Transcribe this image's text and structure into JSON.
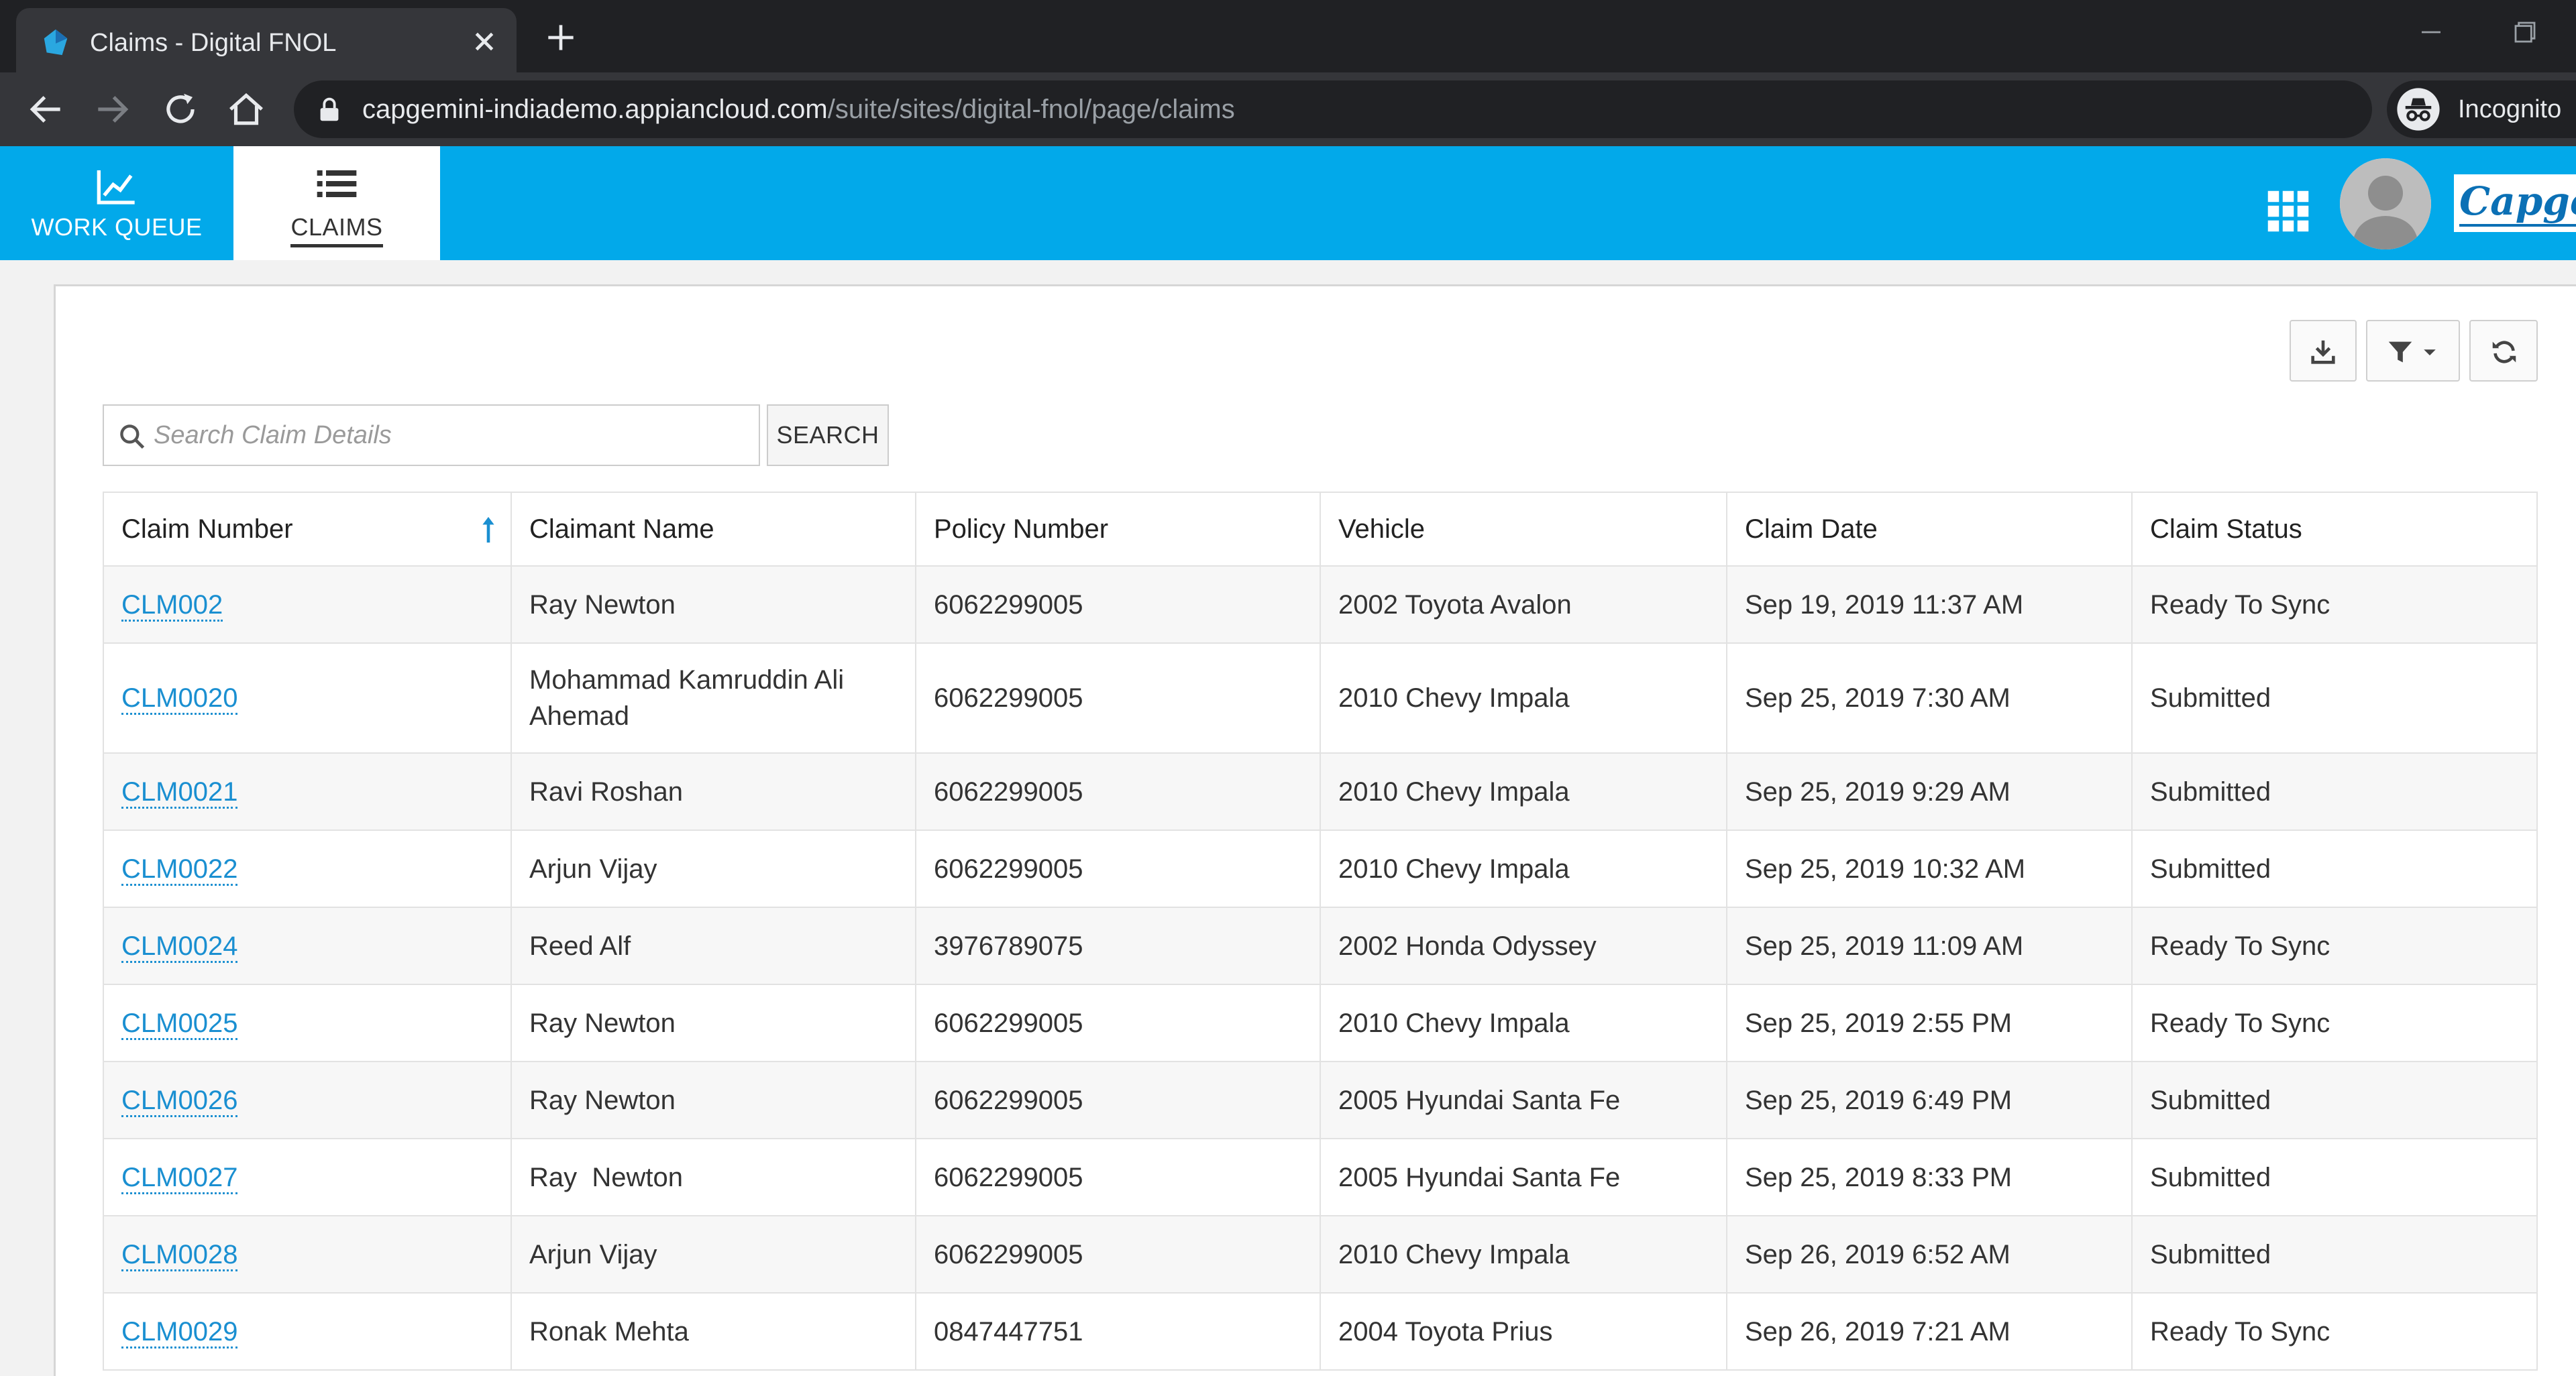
{
  "browser": {
    "tab_title": "Claims - Digital FNOL",
    "url_host": "capgemini-indiademo.appiancloud.com",
    "url_path": "/suite/sites/digital-fnol/page/claims",
    "profile_label": "Incognito"
  },
  "app": {
    "nav": {
      "work_queue": "WORK QUEUE",
      "claims": "CLAIMS"
    },
    "logo_text": "Capgemini",
    "colors": {
      "header": "#02a9ea",
      "link": "#1a8fd1"
    }
  },
  "search": {
    "placeholder": "Search Claim Details",
    "value": "",
    "button_label": "SEARCH"
  },
  "table": {
    "columns": [
      "Claim Number",
      "Claimant Name",
      "Policy Number",
      "Vehicle",
      "Claim Date",
      "Claim Status"
    ],
    "sorted_column": "Claim Number",
    "sort_direction": "ascending",
    "rows": [
      {
        "claim_number": "CLM002",
        "claimant": "Ray Newton",
        "policy": "6062299005",
        "vehicle": "2002 Toyota Avalon",
        "date": "Sep 19, 2019 11:37 AM",
        "status": "Ready To Sync"
      },
      {
        "claim_number": "CLM0020",
        "claimant": "Mohammad Kamruddin Ali Ahemad",
        "policy": "6062299005",
        "vehicle": "2010 Chevy Impala",
        "date": "Sep 25, 2019 7:30 AM",
        "status": "Submitted"
      },
      {
        "claim_number": "CLM0021",
        "claimant": "Ravi Roshan",
        "policy": "6062299005",
        "vehicle": "2010 Chevy Impala",
        "date": "Sep 25, 2019 9:29 AM",
        "status": "Submitted"
      },
      {
        "claim_number": "CLM0022",
        "claimant": "Arjun Vijay",
        "policy": "6062299005",
        "vehicle": "2010 Chevy Impala",
        "date": "Sep 25, 2019 10:32 AM",
        "status": "Submitted"
      },
      {
        "claim_number": "CLM0024",
        "claimant": "Reed Alf",
        "policy": "3976789075",
        "vehicle": "2002 Honda Odyssey",
        "date": "Sep 25, 2019 11:09 AM",
        "status": "Ready To Sync"
      },
      {
        "claim_number": "CLM0025",
        "claimant": "Ray Newton",
        "policy": "6062299005",
        "vehicle": "2010 Chevy Impala",
        "date": "Sep 25, 2019 2:55 PM",
        "status": "Ready To Sync"
      },
      {
        "claim_number": "CLM0026",
        "claimant": "Ray Newton",
        "policy": "6062299005",
        "vehicle": "2005 Hyundai Santa Fe",
        "date": "Sep 25, 2019 6:49 PM",
        "status": "Submitted"
      },
      {
        "claim_number": "CLM0027",
        "claimant": "Ray  Newton",
        "policy": "6062299005",
        "vehicle": "2005 Hyundai Santa Fe",
        "date": "Sep 25, 2019 8:33 PM",
        "status": "Submitted"
      },
      {
        "claim_number": "CLM0028",
        "claimant": "Arjun Vijay",
        "policy": "6062299005",
        "vehicle": "2010 Chevy Impala",
        "date": "Sep 26, 2019 6:52 AM",
        "status": "Submitted"
      },
      {
        "claim_number": "CLM0029",
        "claimant": "Ronak Mehta",
        "policy": "0847447751",
        "vehicle": "2004 Toyota Prius",
        "date": "Sep 26, 2019 7:21 AM",
        "status": "Ready To Sync"
      }
    ]
  }
}
